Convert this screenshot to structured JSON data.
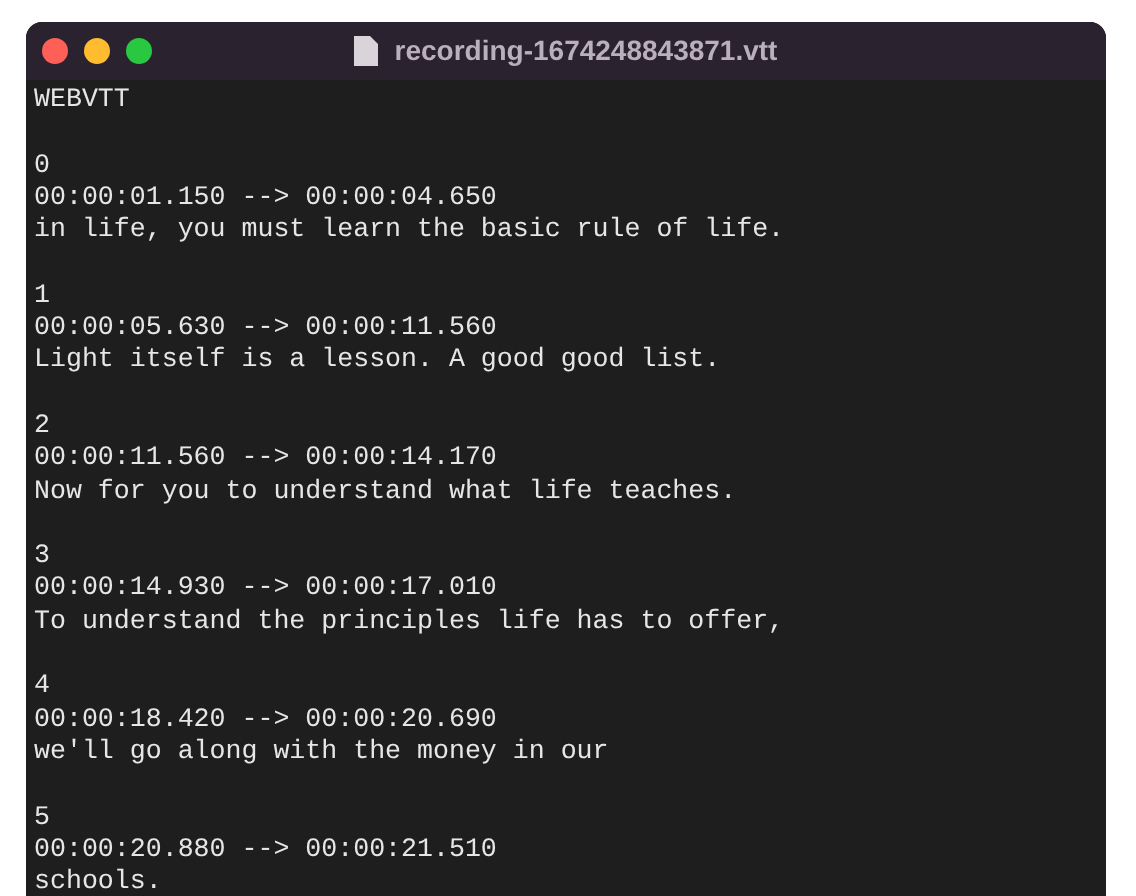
{
  "window": {
    "title": "recording-1674248843871.vtt"
  },
  "header": "WEBVTT",
  "cues": [
    {
      "index": "0",
      "timing": "00:00:01.150 --> 00:00:04.650",
      "text": "in life, you must learn the basic rule of life."
    },
    {
      "index": "1",
      "timing": "00:00:05.630 --> 00:00:11.560",
      "text": "Light itself is a lesson. A good good list."
    },
    {
      "index": "2",
      "timing": "00:00:11.560 --> 00:00:14.170",
      "text": "Now for you to understand what life teaches."
    },
    {
      "index": "3",
      "timing": "00:00:14.930 --> 00:00:17.010",
      "text": "To understand the principles life has to offer,"
    },
    {
      "index": "4",
      "timing": "00:00:18.420 --> 00:00:20.690",
      "text": "we'll go along with the money in our"
    },
    {
      "index": "5",
      "timing": "00:00:20.880 --> 00:00:21.510",
      "text": "schools."
    }
  ]
}
